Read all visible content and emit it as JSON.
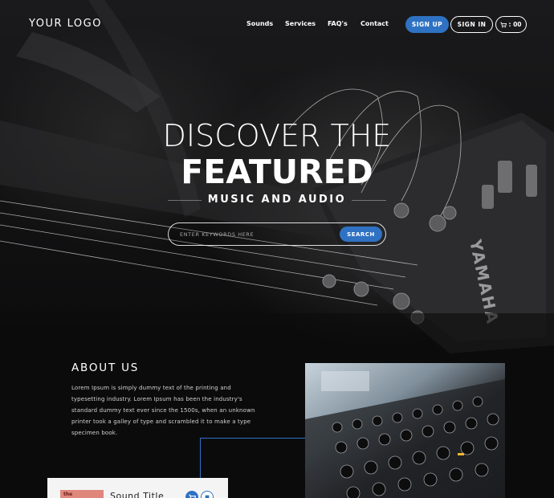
{
  "header": {
    "logo": "YOUR LOGO",
    "nav": [
      {
        "label": "Sounds"
      },
      {
        "label": "Services"
      },
      {
        "label": "FAQ's"
      },
      {
        "label": "Contact"
      }
    ],
    "signup_label": "SIGN UP",
    "signin_label": "SIGN IN",
    "cart_label": ": 00",
    "cart_icon": "cart-icon"
  },
  "hero": {
    "line1": "DISCOVER THE",
    "line2": "FEATURED",
    "line3": "MUSIC AND AUDIO",
    "background_icon": "guitar-headstock-image",
    "search": {
      "placeholder": "ENTER KEYWORDS HERE",
      "value": "",
      "button_label": "SEARCH"
    }
  },
  "about": {
    "title": "ABOUT US",
    "body": "Lorem Ipsum is simply dummy text of the printing and typesetting industry. Lorem Ipsum has been the industry's standard dummy text ever since the 1500s, when an unknown printer took a galley of type and scrambled it to make a type specimen book.",
    "image_icon": "audio-mixer-image"
  },
  "player": {
    "title": "Sound Title",
    "thumb_text": "the",
    "cart_icon": "cart-icon",
    "download_icon": "download-icon"
  },
  "colors": {
    "accent": "#2f72c3",
    "background": "#0b0b0c",
    "text": "#ffffff"
  }
}
